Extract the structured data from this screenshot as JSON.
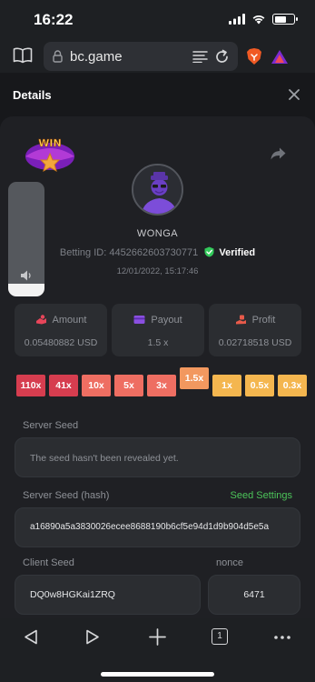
{
  "status_bar": {
    "time": "16:22"
  },
  "browser": {
    "url": "bc.game"
  },
  "modal": {
    "title": "Details"
  },
  "bet": {
    "username": "WONGA",
    "betting_id_label": "Betting ID:",
    "betting_id": "4452662603730771",
    "verified": "Verified",
    "datetime": "12/01/2022, 15:17:46",
    "win_badge": "WIN"
  },
  "stats": {
    "amount": {
      "label": "Amount",
      "value": "0.05480882 USD"
    },
    "payout": {
      "label": "Payout",
      "value": "1.5 x"
    },
    "profit": {
      "label": "Profit",
      "value": "0.02718518 USD"
    }
  },
  "multipliers": [
    "110x",
    "41x",
    "10x",
    "5x",
    "3x",
    "1.5x",
    "1x",
    "0.5x",
    "0.3x"
  ],
  "selected_multiplier": "1.5x",
  "server_seed": {
    "label": "Server Seed",
    "value": "The seed hasn't been revealed yet."
  },
  "server_seed_hash": {
    "label": "Server Seed (hash)",
    "settings_link": "Seed Settings",
    "value": "a16890a5a3830026ecee8688190b6cf5e94d1d9b904d5e5a"
  },
  "client_seed": {
    "label": "Client Seed",
    "value": "DQ0w8HGKai1ZRQ"
  },
  "nonce": {
    "label": "nonce",
    "value": "6471"
  },
  "bottom_nav": {
    "tab_count": "1"
  },
  "colors": {
    "accent_green": "#4cc45a",
    "verified_green": "#32c95a",
    "mult_red": "#d63d4f",
    "mult_orange": "#f2985f",
    "mult_yellow": "#f4b64f"
  }
}
